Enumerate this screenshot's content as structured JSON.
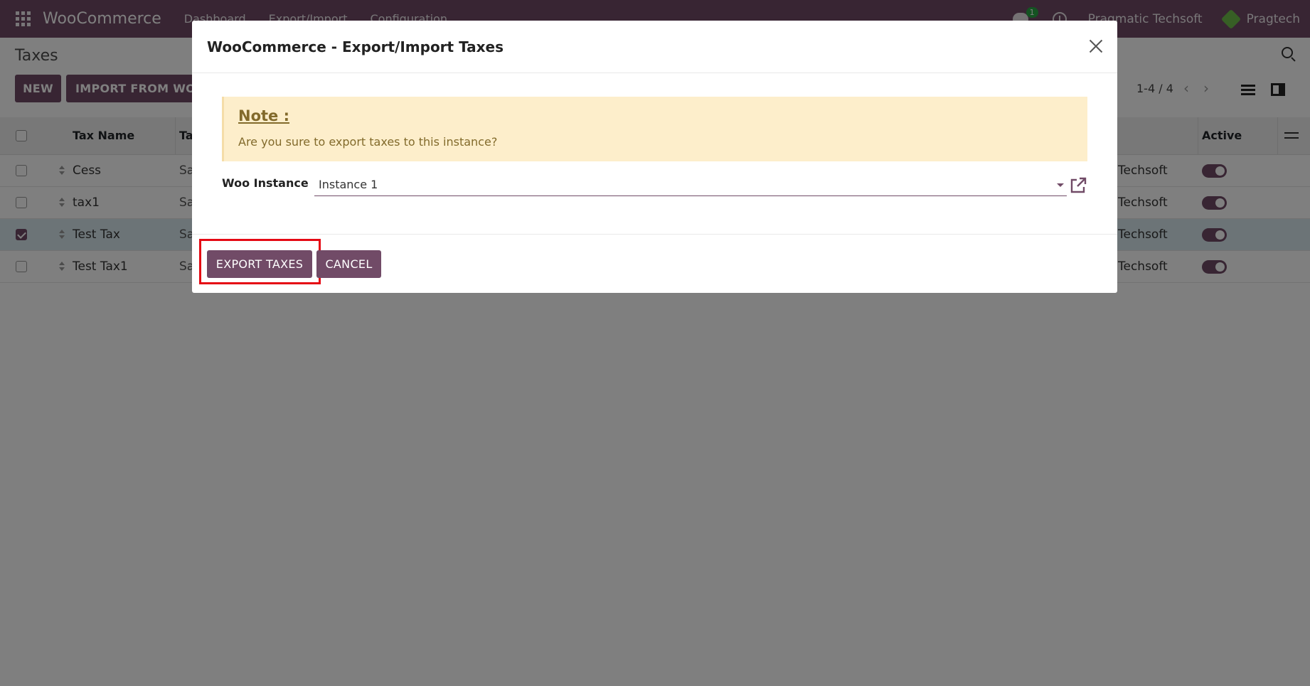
{
  "navbar": {
    "brand": "WooCommerce",
    "menu": [
      "Dashboard",
      "Export/Import",
      "Configuration"
    ],
    "chat_badge": "1",
    "company": "Pragmatic Techsoft",
    "user": "Pragtech"
  },
  "control_panel": {
    "title": "Taxes",
    "new_label": "NEW",
    "import_label": "IMPORT FROM WOOCOMMERCE",
    "pager": "1-4 / 4"
  },
  "table": {
    "columns": {
      "name": "Tax Name",
      "type": "Ta",
      "active": "Active"
    },
    "rows": [
      {
        "name": "Cess",
        "type": "Sa",
        "company": "Techsoft",
        "selected": false
      },
      {
        "name": "tax1",
        "type": "Sa",
        "company": "Techsoft",
        "selected": false
      },
      {
        "name": "Test Tax",
        "type": "Sa",
        "company": "Techsoft",
        "selected": true
      },
      {
        "name": "Test Tax1",
        "type": "Sa",
        "company": "Techsoft",
        "selected": false
      }
    ]
  },
  "modal": {
    "title": "WooCommerce - Export/Import Taxes",
    "note_title": "Note :",
    "note_text": "Are you sure to export taxes to this instance?",
    "field_label": "Woo Instance",
    "field_value": "Instance 1",
    "export_label": "EXPORT TAXES",
    "cancel_label": "CANCEL"
  },
  "colors": {
    "brand": "#714b67",
    "note_bg": "#fdeecb",
    "highlight": "#e50914"
  }
}
